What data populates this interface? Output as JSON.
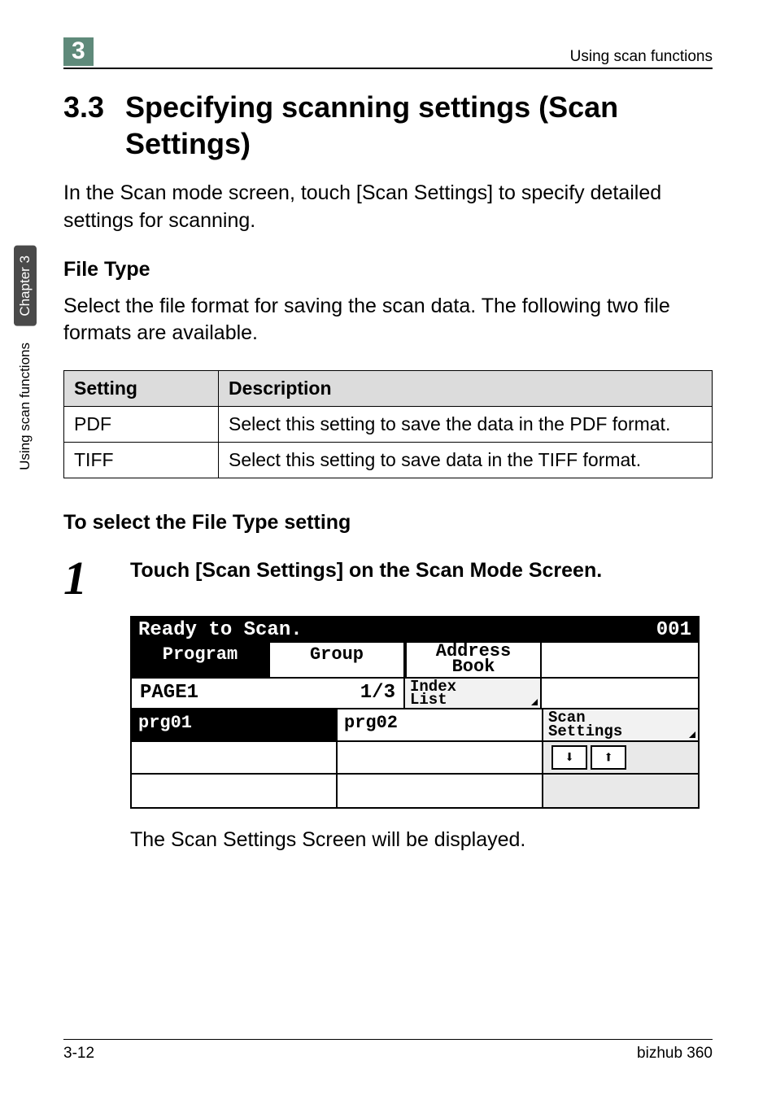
{
  "header": {
    "chapter_badge": "3",
    "running_head": "Using scan functions"
  },
  "side": {
    "dark_label": "Chapter 3",
    "light_label": "Using scan functions"
  },
  "section": {
    "number": "3.3",
    "title": "Specifying scanning settings (Scan Settings)",
    "intro": "In the Scan mode screen, touch [Scan Settings] to specify detailed settings for scanning."
  },
  "filetype": {
    "heading": "File Type",
    "intro": "Select the file format for saving the scan data. The following two file formats are available.",
    "columns": {
      "setting": "Setting",
      "description": "Description"
    },
    "rows": [
      {
        "setting": "PDF",
        "description": "Select this setting to save the data in the PDF format."
      },
      {
        "setting": "TIFF",
        "description": "Select this setting to save data in the TIFF format."
      }
    ]
  },
  "procedure": {
    "heading": "To select the File Type setting",
    "step": {
      "number": "1",
      "text": "Touch [Scan Settings] on the Scan Mode Screen."
    },
    "result": "The Scan Settings Screen will be displayed."
  },
  "lcd": {
    "status": "Ready to Scan.",
    "counter": "001",
    "tabs": {
      "program": "Program",
      "group": "Group",
      "address_book": "Address\nBook"
    },
    "page_label": "PAGE1",
    "page_count": "1/3",
    "index_list": "Index\nList",
    "programs": {
      "p1": "prg01",
      "p2": "prg02"
    },
    "scan_settings": "Scan\nSettings",
    "arrow_down": "⬇",
    "arrow_up": "⬆"
  },
  "footer": {
    "left": "3-12",
    "right": "bizhub 360"
  }
}
